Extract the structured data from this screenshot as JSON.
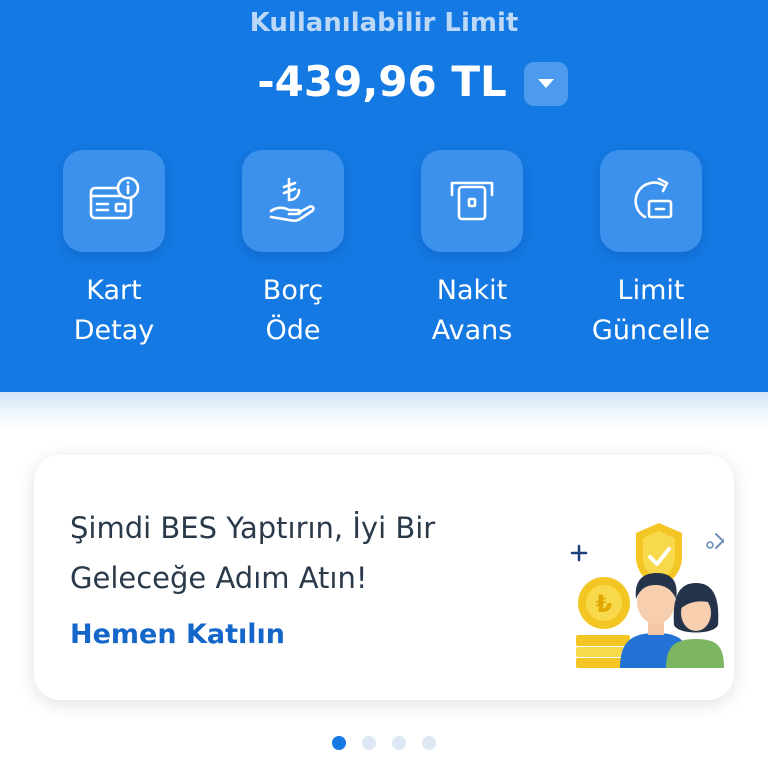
{
  "limit": {
    "label": "Kullanılabilir Limit",
    "amount": "-439,96 TL"
  },
  "actions": [
    {
      "line1": "Kart",
      "line2": "Detay",
      "icon": "card-info-icon"
    },
    {
      "line1": "Borç",
      "line2": "Öde",
      "icon": "lira-hand-icon"
    },
    {
      "line1": "Nakit",
      "line2": "Avans",
      "icon": "cash-withdraw-icon"
    },
    {
      "line1": "Limit",
      "line2": "Güncelle",
      "icon": "limit-refresh-icon"
    }
  ],
  "promo": {
    "title": "Şimdi BES Yaptırın, İyi Bir Geleceğe Adım Atın!",
    "cta": "Hemen Katılın"
  },
  "pagination": {
    "total": 4,
    "active": 1
  },
  "colors": {
    "primary": "#1479e3",
    "tile": "#3b91ec",
    "link": "#1466c8",
    "text": "#2b3a4a"
  }
}
